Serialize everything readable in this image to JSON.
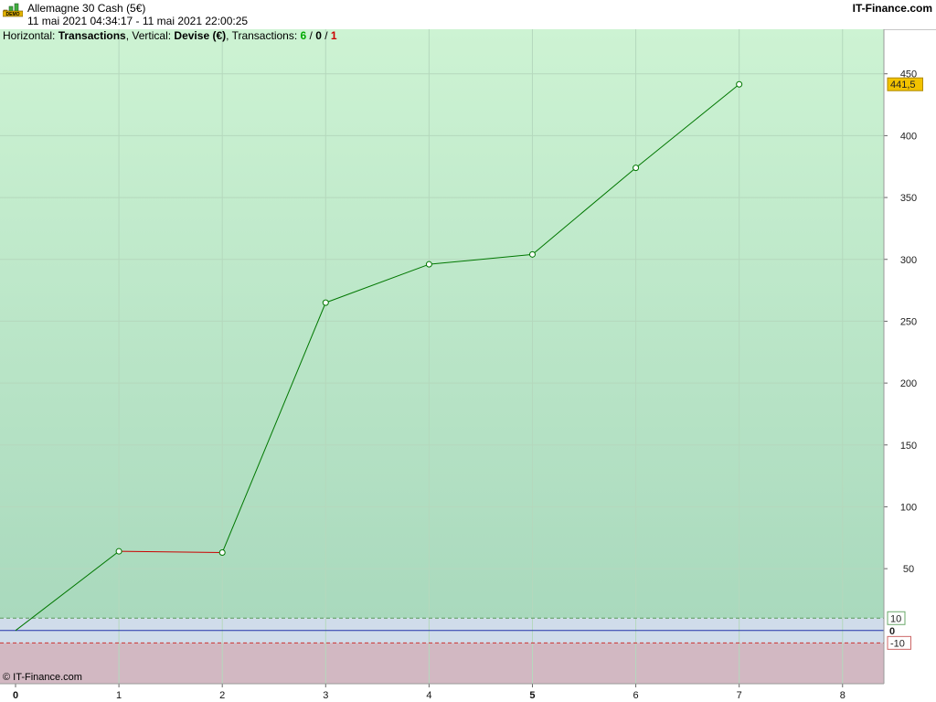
{
  "header": {
    "title": "Allemagne 30 Cash (5€)",
    "date_range": "11 mai 2021 04:34:17 - 11 mai 2021 22:00:25",
    "brand": "IT-Finance.com",
    "logo_icon": "demo-chart-icon"
  },
  "info": {
    "horizontal_label": "Horizontal: ",
    "horizontal_value": "Transactions",
    "vertical_label": ", Vertical: ",
    "vertical_value": "Devise (€)",
    "transactions_label": ", Transactions: ",
    "wins": "6",
    "sep1": " / ",
    "neutral": "0",
    "sep2": " / ",
    "losses": "1"
  },
  "footer": {
    "copyright": "© IT-Finance.com"
  },
  "colors": {
    "profit_bg_top": "#cdf3d3",
    "profit_bg_bottom": "#a9d9bd",
    "neutral_band": "#d0dcea",
    "loss_bg": "#d2b8c2",
    "up_line": "#007700",
    "down_line": "#cc0000",
    "zero_line": "#2233aa",
    "last_value_bg": "#f2c200"
  },
  "chart_data": {
    "type": "line",
    "title": "",
    "xlabel": "",
    "ylabel": "",
    "x": [
      0,
      1,
      2,
      3,
      4,
      5,
      6,
      7
    ],
    "y": [
      0,
      64,
      63,
      265,
      296,
      304,
      374,
      441.5
    ],
    "x_ticks": [
      "0",
      "1",
      "2",
      "3",
      "4",
      "5",
      "6",
      "7",
      "8"
    ],
    "y_ticks": [
      50,
      100,
      150,
      200,
      250,
      300,
      350,
      400,
      450
    ],
    "zero_label": "0",
    "upper_threshold": 10,
    "upper_threshold_label": "10",
    "lower_threshold": -10,
    "lower_threshold_label": "-10",
    "last_value_label": "441,5",
    "xlim": [
      0,
      8.4
    ],
    "ylim": [
      -43,
      486
    ],
    "grid": true
  }
}
